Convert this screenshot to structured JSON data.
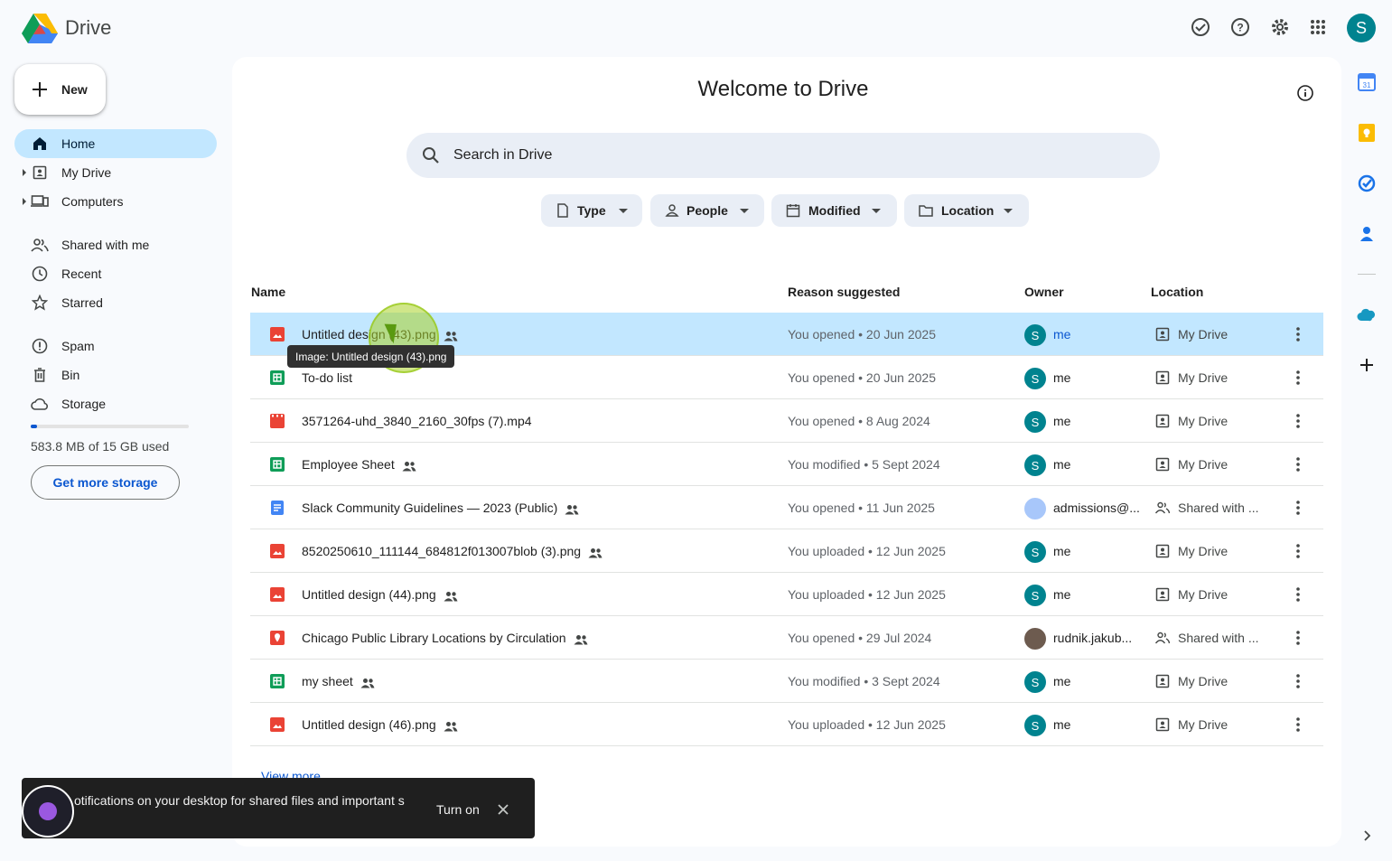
{
  "app": {
    "title": "Drive"
  },
  "colors": {
    "accent": "#0b57d0",
    "selected": "#c2e7ff",
    "avatar": "#00838f"
  },
  "header": {
    "icons": [
      "ready-for-offline-icon",
      "help-icon",
      "settings-icon",
      "apps-grid-icon"
    ],
    "avatar_initial": "S"
  },
  "sidebar": {
    "new_label": "New",
    "items": [
      {
        "label": "Home",
        "icon": "home-icon",
        "active": true
      },
      {
        "label": "My Drive",
        "icon": "my-drive-icon"
      },
      {
        "label": "Computers",
        "icon": "computers-icon"
      },
      {
        "label": "Shared with me",
        "icon": "shared-icon"
      },
      {
        "label": "Recent",
        "icon": "clock-icon"
      },
      {
        "label": "Starred",
        "icon": "star-icon"
      },
      {
        "label": "Spam",
        "icon": "spam-icon"
      },
      {
        "label": "Bin",
        "icon": "bin-icon"
      },
      {
        "label": "Storage",
        "icon": "cloud-icon"
      }
    ],
    "storage_text": "583.8 MB of 15 GB used",
    "storage_fraction": 0.039,
    "get_storage_label": "Get more storage"
  },
  "main": {
    "welcome": "Welcome to Drive",
    "search_placeholder": "Search in Drive",
    "filters": [
      {
        "label": "Type"
      },
      {
        "label": "People"
      },
      {
        "label": "Modified"
      },
      {
        "label": "Location"
      }
    ],
    "columns": {
      "name": "Name",
      "reason": "Reason suggested",
      "owner": "Owner",
      "location": "Location"
    },
    "rows": [
      {
        "name": "Untitled design (43).png",
        "type": "image",
        "shared": true,
        "reason": "You opened • 20 Jun 2025",
        "owner": "me",
        "owner_initial": "S",
        "location": "My Drive"
      },
      {
        "name": "To-do list",
        "type": "sheet",
        "shared": false,
        "reason": "You opened • 20 Jun 2025",
        "owner": "me",
        "owner_initial": "S",
        "location": "My Drive"
      },
      {
        "name": "3571264-uhd_3840_2160_30fps (7).mp4",
        "type": "video",
        "shared": false,
        "reason": "You opened • 8 Aug 2024",
        "owner": "me",
        "owner_initial": "S",
        "location": "My Drive"
      },
      {
        "name": "Employee Sheet",
        "type": "sheet",
        "shared": true,
        "reason": "You modified • 5 Sept 2024",
        "owner": "me",
        "owner_initial": "S",
        "location": "My Drive"
      },
      {
        "name": "Slack Community Guidelines — 2023 (Public)",
        "type": "doc",
        "shared": true,
        "reason": "You opened • 11 Jun 2025",
        "owner": "admissions@...",
        "owner_initial": "",
        "location": "Shared with ..."
      },
      {
        "name": "8520250610_111144_684812f013007blob (3).png",
        "type": "image",
        "shared": true,
        "reason": "You uploaded • 12 Jun 2025",
        "owner": "me",
        "owner_initial": "S",
        "location": "My Drive"
      },
      {
        "name": "Untitled design (44).png",
        "type": "image",
        "shared": true,
        "reason": "You uploaded • 12 Jun 2025",
        "owner": "me",
        "owner_initial": "S",
        "location": "My Drive"
      },
      {
        "name": "Chicago Public Library Locations by Circulation",
        "type": "map",
        "shared": true,
        "reason": "You opened • 29 Jul 2024",
        "owner": "rudnik.jakub...",
        "owner_initial": "",
        "location": "Shared with ..."
      },
      {
        "name": "my sheet",
        "type": "sheet",
        "shared": true,
        "reason": "You modified • 3 Sept 2024",
        "owner": "me",
        "owner_initial": "S",
        "location": "My Drive"
      },
      {
        "name": "Untitled design (46).png",
        "type": "image",
        "shared": true,
        "reason": "You uploaded • 12 Jun 2025",
        "owner": "me",
        "owner_initial": "S",
        "location": "My Drive"
      }
    ],
    "tooltip": "Image: Untitled design (43).png",
    "view_more": "View more"
  },
  "right_panel": {
    "apps": [
      "calendar-icon",
      "keep-icon",
      "tasks-icon",
      "contacts-icon",
      "salesforce-icon",
      "add-icon"
    ]
  },
  "snackbar": {
    "text": "otifications on your desktop for shared files and important s",
    "button": "Turn on"
  }
}
